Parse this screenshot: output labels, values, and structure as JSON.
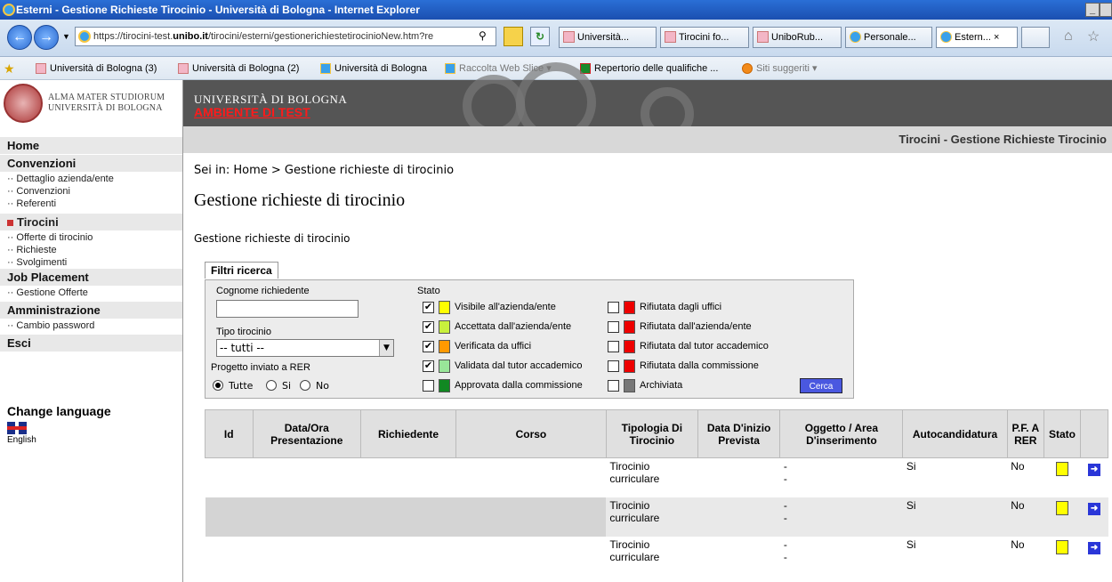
{
  "browser": {
    "title": "Esterni - Gestione Richieste Tirocinio - Università di Bologna - Internet Explorer",
    "url_pre": "https://tirocini-test.",
    "url_host": "unibo.it",
    "url_post": "/tirocini/esterni/gestionerichiestetirocinioNew.htm?re",
    "tabs": [
      "Università...",
      "Tirocini fo...",
      "UniboRub...",
      "Personale...",
      "Estern..."
    ],
    "favorites": [
      "Università di Bologna (3)",
      "Università di Bologna (2)",
      "Università di Bologna",
      "Raccolta Web Slice",
      "Repertorio delle qualifiche ...",
      "Siti suggeriti"
    ]
  },
  "header": {
    "logo_line1": "ALMA MATER STUDIORUM",
    "logo_line2": "UNIVERSITÀ DI BOLOGNA",
    "brand": "UNIVERSITÀ DI BOLOGNA",
    "env": "AMBIENTE DI TEST",
    "section_title": "Tirocini - Gestione Richieste Tirocinio"
  },
  "sidebar": {
    "home": "Home",
    "convenzioni": "Convenzioni",
    "conv_items": [
      "Dettaglio azienda/ente",
      "Convenzioni",
      "Referenti"
    ],
    "tirocini": "Tirocini",
    "tir_items": [
      "Offerte di tirocinio",
      "Richieste",
      "Svolgimenti"
    ],
    "job": "Job Placement",
    "job_items": [
      "Gestione Offerte"
    ],
    "admin": "Amministrazione",
    "admin_items": [
      "Cambio password"
    ],
    "esci": "Esci",
    "change_language": "Change language",
    "english": "English"
  },
  "main": {
    "breadcrumb": "Sei in: Home > Gestione richieste di tirocinio",
    "title": "Gestione richieste di tirocinio",
    "subtitle": "Gestione richieste di tirocinio",
    "filters_tab": "Filtri ricerca",
    "cognome_label": "Cognome richiedente",
    "cognome_value": "",
    "tipo_label": "Tipo tirocinio",
    "tipo_value": "-- tutti --",
    "rer_label": "Progetto inviato a RER",
    "rer_options": [
      "Tutte",
      "Si",
      "No"
    ],
    "stato_label": "Stato",
    "stati_left": [
      {
        "label": "Visibile all'azienda/ente",
        "checked": true,
        "color": "#ffff00"
      },
      {
        "label": "Accettata dall'azienda/ente",
        "checked": true,
        "color": "#c8f03c"
      },
      {
        "label": "Verificata da uffici",
        "checked": true,
        "color": "#ff9900"
      },
      {
        "label": "Validata dal tutor accademico",
        "checked": true,
        "color": "#99e699"
      },
      {
        "label": "Approvata dalla commissione",
        "checked": false,
        "color": "#118822"
      }
    ],
    "stati_right": [
      {
        "label": "Rifiutata dagli uffici",
        "checked": false,
        "color": "#ee0000"
      },
      {
        "label": "Rifiutata dall'azienda/ente",
        "checked": false,
        "color": "#ee0000"
      },
      {
        "label": "Rifiutata dal tutor accademico",
        "checked": false,
        "color": "#ee0000"
      },
      {
        "label": "Rifiutata dalla commissione",
        "checked": false,
        "color": "#ee0000"
      },
      {
        "label": "Archiviata",
        "checked": false,
        "color": "#777777"
      }
    ],
    "cerca": "Cerca"
  },
  "table": {
    "headers": [
      "Id",
      "Data/Ora Presentazione",
      "Richiedente",
      "Corso",
      "Tipologia Di Tirocinio",
      "Data D'inizio Prevista",
      "Oggetto / Area D'inserimento",
      "Autocandidatura",
      "P.F. A RER",
      "Stato",
      ""
    ],
    "rows": [
      {
        "tipologia": "Tirocinio curriculare",
        "oggetto1": "-",
        "oggetto2": "-",
        "auto": "Si",
        "rer": "No"
      },
      {
        "tipologia": "Tirocinio curriculare",
        "oggetto1": "-",
        "oggetto2": "-",
        "auto": "Si",
        "rer": "No"
      },
      {
        "tipologia": "Tirocinio curriculare",
        "oggetto1": "-",
        "oggetto2": "-",
        "auto": "Si",
        "rer": "No"
      }
    ]
  }
}
